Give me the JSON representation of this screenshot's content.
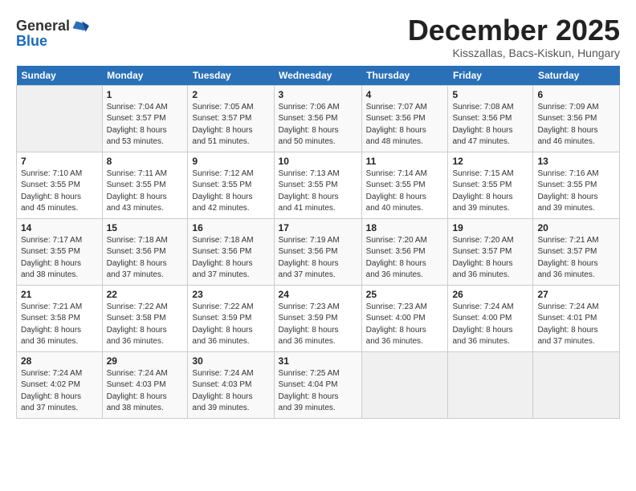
{
  "logo": {
    "general": "General",
    "blue": "Blue"
  },
  "header": {
    "month": "December 2025",
    "location": "Kisszallas, Bacs-Kiskun, Hungary"
  },
  "days_of_week": [
    "Sunday",
    "Monday",
    "Tuesday",
    "Wednesday",
    "Thursday",
    "Friday",
    "Saturday"
  ],
  "weeks": [
    [
      {
        "day": "",
        "info": ""
      },
      {
        "day": "1",
        "info": "Sunrise: 7:04 AM\nSunset: 3:57 PM\nDaylight: 8 hours\nand 53 minutes."
      },
      {
        "day": "2",
        "info": "Sunrise: 7:05 AM\nSunset: 3:57 PM\nDaylight: 8 hours\nand 51 minutes."
      },
      {
        "day": "3",
        "info": "Sunrise: 7:06 AM\nSunset: 3:56 PM\nDaylight: 8 hours\nand 50 minutes."
      },
      {
        "day": "4",
        "info": "Sunrise: 7:07 AM\nSunset: 3:56 PM\nDaylight: 8 hours\nand 48 minutes."
      },
      {
        "day": "5",
        "info": "Sunrise: 7:08 AM\nSunset: 3:56 PM\nDaylight: 8 hours\nand 47 minutes."
      },
      {
        "day": "6",
        "info": "Sunrise: 7:09 AM\nSunset: 3:56 PM\nDaylight: 8 hours\nand 46 minutes."
      }
    ],
    [
      {
        "day": "7",
        "info": "Sunrise: 7:10 AM\nSunset: 3:55 PM\nDaylight: 8 hours\nand 45 minutes."
      },
      {
        "day": "8",
        "info": "Sunrise: 7:11 AM\nSunset: 3:55 PM\nDaylight: 8 hours\nand 43 minutes."
      },
      {
        "day": "9",
        "info": "Sunrise: 7:12 AM\nSunset: 3:55 PM\nDaylight: 8 hours\nand 42 minutes."
      },
      {
        "day": "10",
        "info": "Sunrise: 7:13 AM\nSunset: 3:55 PM\nDaylight: 8 hours\nand 41 minutes."
      },
      {
        "day": "11",
        "info": "Sunrise: 7:14 AM\nSunset: 3:55 PM\nDaylight: 8 hours\nand 40 minutes."
      },
      {
        "day": "12",
        "info": "Sunrise: 7:15 AM\nSunset: 3:55 PM\nDaylight: 8 hours\nand 39 minutes."
      },
      {
        "day": "13",
        "info": "Sunrise: 7:16 AM\nSunset: 3:55 PM\nDaylight: 8 hours\nand 39 minutes."
      }
    ],
    [
      {
        "day": "14",
        "info": "Sunrise: 7:17 AM\nSunset: 3:55 PM\nDaylight: 8 hours\nand 38 minutes."
      },
      {
        "day": "15",
        "info": "Sunrise: 7:18 AM\nSunset: 3:56 PM\nDaylight: 8 hours\nand 37 minutes."
      },
      {
        "day": "16",
        "info": "Sunrise: 7:18 AM\nSunset: 3:56 PM\nDaylight: 8 hours\nand 37 minutes."
      },
      {
        "day": "17",
        "info": "Sunrise: 7:19 AM\nSunset: 3:56 PM\nDaylight: 8 hours\nand 37 minutes."
      },
      {
        "day": "18",
        "info": "Sunrise: 7:20 AM\nSunset: 3:56 PM\nDaylight: 8 hours\nand 36 minutes."
      },
      {
        "day": "19",
        "info": "Sunrise: 7:20 AM\nSunset: 3:57 PM\nDaylight: 8 hours\nand 36 minutes."
      },
      {
        "day": "20",
        "info": "Sunrise: 7:21 AM\nSunset: 3:57 PM\nDaylight: 8 hours\nand 36 minutes."
      }
    ],
    [
      {
        "day": "21",
        "info": "Sunrise: 7:21 AM\nSunset: 3:58 PM\nDaylight: 8 hours\nand 36 minutes."
      },
      {
        "day": "22",
        "info": "Sunrise: 7:22 AM\nSunset: 3:58 PM\nDaylight: 8 hours\nand 36 minutes."
      },
      {
        "day": "23",
        "info": "Sunrise: 7:22 AM\nSunset: 3:59 PM\nDaylight: 8 hours\nand 36 minutes."
      },
      {
        "day": "24",
        "info": "Sunrise: 7:23 AM\nSunset: 3:59 PM\nDaylight: 8 hours\nand 36 minutes."
      },
      {
        "day": "25",
        "info": "Sunrise: 7:23 AM\nSunset: 4:00 PM\nDaylight: 8 hours\nand 36 minutes."
      },
      {
        "day": "26",
        "info": "Sunrise: 7:24 AM\nSunset: 4:00 PM\nDaylight: 8 hours\nand 36 minutes."
      },
      {
        "day": "27",
        "info": "Sunrise: 7:24 AM\nSunset: 4:01 PM\nDaylight: 8 hours\nand 37 minutes."
      }
    ],
    [
      {
        "day": "28",
        "info": "Sunrise: 7:24 AM\nSunset: 4:02 PM\nDaylight: 8 hours\nand 37 minutes."
      },
      {
        "day": "29",
        "info": "Sunrise: 7:24 AM\nSunset: 4:03 PM\nDaylight: 8 hours\nand 38 minutes."
      },
      {
        "day": "30",
        "info": "Sunrise: 7:24 AM\nSunset: 4:03 PM\nDaylight: 8 hours\nand 39 minutes."
      },
      {
        "day": "31",
        "info": "Sunrise: 7:25 AM\nSunset: 4:04 PM\nDaylight: 8 hours\nand 39 minutes."
      },
      {
        "day": "",
        "info": ""
      },
      {
        "day": "",
        "info": ""
      },
      {
        "day": "",
        "info": ""
      }
    ]
  ]
}
